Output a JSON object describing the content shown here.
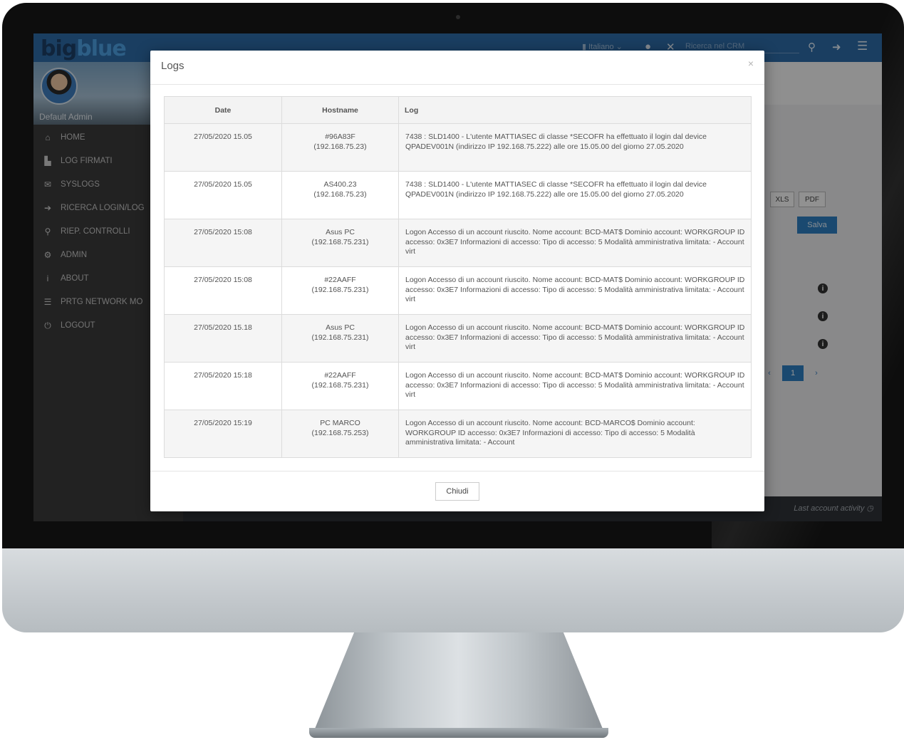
{
  "app": {
    "logo_text": "big",
    "logo_text_accent": "blue",
    "language": "Italiano",
    "search_placeholder": "Ricerca nel CRM",
    "user_name": "Default Admin",
    "last_activity": "Last account activity"
  },
  "sidebar": {
    "items": [
      {
        "label": "HOME",
        "icon": "home-icon"
      },
      {
        "label": "LOG FIRMATI",
        "icon": "signed-log-icon"
      },
      {
        "label": "SYSLOGS",
        "icon": "envelope-icon"
      },
      {
        "label": "RICERCA LOGIN/LOG",
        "icon": "login-icon"
      },
      {
        "label": "RIEP. CONTROLLI",
        "icon": "search-icon"
      },
      {
        "label": "ADMIN",
        "icon": "gears-icon"
      },
      {
        "label": "ABOUT",
        "icon": "info-icon"
      },
      {
        "label": "PRTG NETWORK MO",
        "icon": "list-icon"
      },
      {
        "label": "LOGOUT",
        "icon": "power-icon"
      }
    ]
  },
  "background": {
    "xls_label": "XLS",
    "pdf_label": "PDF",
    "save_label": "Salva",
    "page_current": "1",
    "prev_label": "‹",
    "next_label": "›"
  },
  "modal": {
    "title": "Logs",
    "close_symbol": "×",
    "close_button": "Chiudi",
    "columns": {
      "date": "Date",
      "hostname": "Hostname",
      "log": "Log"
    },
    "rows": [
      {
        "date": "27/05/2020 15.05",
        "host": "#96A83F",
        "ip": "(192.168.75.23)",
        "log": "7438 : SLD1400 - L'utente MATTIASEC di classe *SECOFR ha effettuato il login dal device QPADEV001N (indirizzo IP 192.168.75.222) alle ore 15.05.00 del giorno 27.05.2020"
      },
      {
        "date": "27/05/2020 15.05",
        "host": "AS400.23",
        "ip": "(192.168.75.23)",
        "log": "7438 : SLD1400 - L'utente MATTIASEC di classe *SECOFR ha effettuato il login dal device QPADEV001N (indirizzo IP 192.168.75.222) alle ore 15.05.00 del giorno 27.05.2020"
      },
      {
        "date": "27/05/2020 15:08",
        "host": "Asus PC",
        "ip": "(192.168.75.231)",
        "log": "Logon Accesso di un account riuscito. Nome account: BCD-MAT$ Dominio account: WORKGROUP ID accesso: 0x3E7 Informazioni di accesso: Tipo di accesso: 5 Modalità amministrativa limitata: - Account virt"
      },
      {
        "date": "27/05/2020 15:08",
        "host": "#22AAFF",
        "ip": "(192.168.75.231)",
        "log": "Logon Accesso di un account riuscito. Nome account: BCD-MAT$ Dominio account: WORKGROUP ID accesso: 0x3E7 Informazioni di accesso: Tipo di accesso: 5 Modalità amministrativa limitata: - Account virt"
      },
      {
        "date": "27/05/2020 15.18",
        "host": "Asus PC",
        "ip": "(192.168.75.231)",
        "log": "Logon Accesso di un account riuscito. Nome account: BCD-MAT$ Dominio account: WORKGROUP ID accesso: 0x3E7 Informazioni di accesso: Tipo di accesso: 5 Modalità amministrativa limitata: - Account virt"
      },
      {
        "date": "27/05/2020 15:18",
        "host": "#22AAFF",
        "ip": "(192.168.75.231)",
        "log": "Logon Accesso di un account riuscito. Nome account: BCD-MAT$ Dominio account: WORKGROUP ID accesso: 0x3E7 Informazioni di accesso: Tipo di accesso: 5 Modalità amministrativa limitata: - Account virt"
      },
      {
        "date": "27/05/2020 15:19",
        "host": "PC MARCO",
        "ip": "(192.168.75.253)",
        "log": "Logon Accesso di un account riuscito. Nome account: BCD-MARCO$ Dominio account: WORKGROUP ID accesso: 0x3E7 Informazioni di accesso: Tipo di accesso: 5 Modalità amministrativa limitata: - Account"
      }
    ]
  }
}
